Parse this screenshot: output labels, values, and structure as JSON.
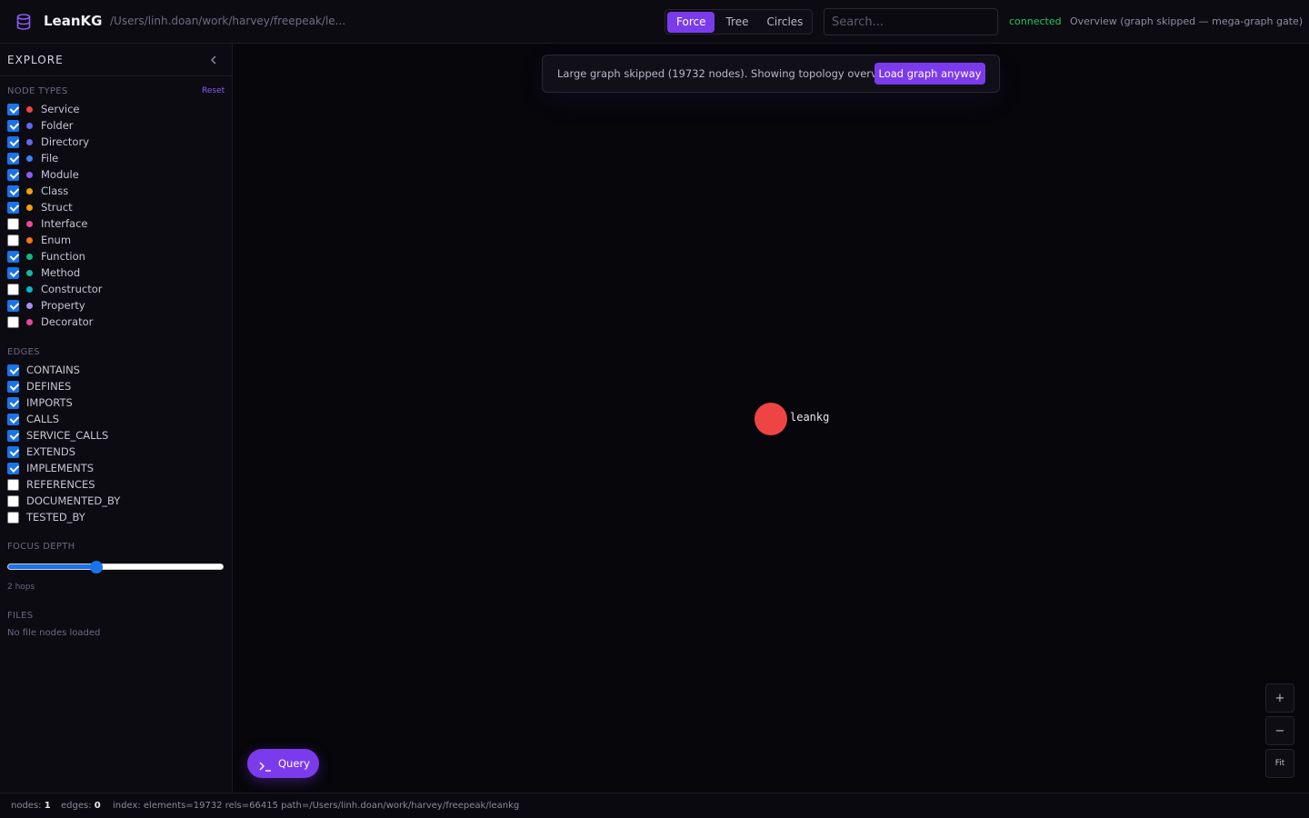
{
  "header": {
    "app_title": "LeanKG",
    "repo_path": "/Users/linh.doan/work/harvey/freepeak/le...",
    "view_modes": [
      "Force",
      "Tree",
      "Circles"
    ],
    "active_view": "Force",
    "search_placeholder": "Search...",
    "connection_status": "connected",
    "overview_status": "Overview (graph skipped — mega-graph gate)",
    "icons": {
      "logo": "database-icon"
    }
  },
  "sidebar": {
    "title": "EXPLORE",
    "collapse_icon": "chevron-left-icon",
    "node_types_label": "NODE TYPES",
    "reset_label": "Reset",
    "node_types": [
      {
        "label": "Service",
        "color": "#ef4444",
        "checked": true
      },
      {
        "label": "Folder",
        "color": "#6366f1",
        "checked": true
      },
      {
        "label": "Directory",
        "color": "#6366f1",
        "checked": true
      },
      {
        "label": "File",
        "color": "#3b82f6",
        "checked": true
      },
      {
        "label": "Module",
        "color": "#8b5cf6",
        "checked": true
      },
      {
        "label": "Class",
        "color": "#f59e0b",
        "checked": true
      },
      {
        "label": "Struct",
        "color": "#f59e0b",
        "checked": true
      },
      {
        "label": "Interface",
        "color": "#ec4899",
        "checked": false
      },
      {
        "label": "Enum",
        "color": "#f97316",
        "checked": false
      },
      {
        "label": "Function",
        "color": "#10b981",
        "checked": true
      },
      {
        "label": "Method",
        "color": "#14b8a6",
        "checked": true
      },
      {
        "label": "Constructor",
        "color": "#06b6d4",
        "checked": false
      },
      {
        "label": "Property",
        "color": "#a78bfa",
        "checked": true
      },
      {
        "label": "Decorator",
        "color": "#ec4899",
        "checked": false
      }
    ],
    "edges_label": "EDGES",
    "edges": [
      {
        "label": "CONTAINS",
        "checked": true
      },
      {
        "label": "DEFINES",
        "checked": true
      },
      {
        "label": "IMPORTS",
        "checked": true
      },
      {
        "label": "CALLS",
        "checked": true
      },
      {
        "label": "SERVICE_CALLS",
        "checked": true
      },
      {
        "label": "EXTENDS",
        "checked": true
      },
      {
        "label": "IMPLEMENTS",
        "checked": true
      },
      {
        "label": "REFERENCES",
        "checked": false
      },
      {
        "label": "DOCUMENTED_BY",
        "checked": false
      },
      {
        "label": "TESTED_BY",
        "checked": false
      }
    ],
    "focus_depth_label": "FOCUS DEPTH",
    "focus_depth_fraction": 0.41,
    "focus_depth_text": "2 hops",
    "files_label": "FILES",
    "files_empty_text": "No file nodes loaded"
  },
  "canvas": {
    "banner_text": "Large graph skipped (19732 nodes). Showing topology overview.",
    "load_button_label": "Load graph anyway",
    "node_label": "leankg",
    "node_color": "#ef4444",
    "zoom_in_label": "+",
    "zoom_out_label": "−",
    "fit_label": "Fit",
    "query_button_label": "Query",
    "query_icon": "terminal-icon"
  },
  "statusbar": {
    "nodes_label": "nodes:",
    "nodes_value": "1",
    "edges_label": "edges:",
    "edges_value": "0",
    "index_text": "index: elements=19732 rels=66415 path=/Users/linh.doan/work/harvey/freepeak/leankg"
  },
  "colors": {
    "accent": "#7c3aed",
    "connected": "#22c55e"
  }
}
